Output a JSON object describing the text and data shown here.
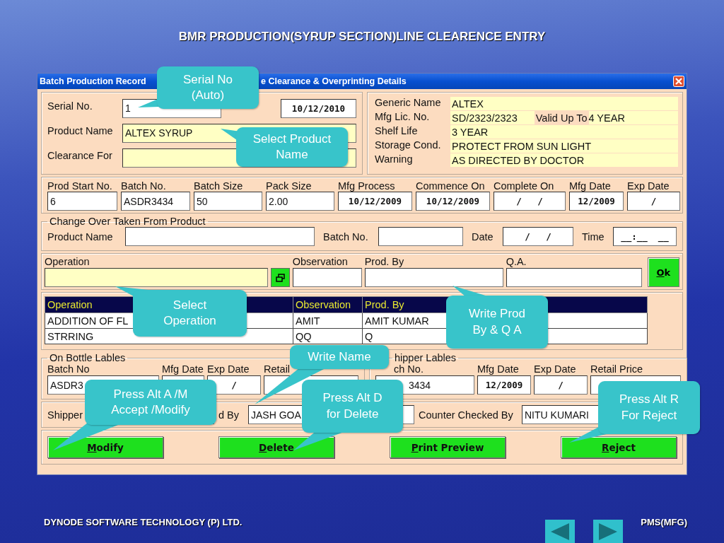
{
  "slide": {
    "title": "BMR PRODUCTION(SYRUP SECTION)LINE CLEARENCE ENTRY",
    "footer": "DYNODE SOFTWARE TECHNOLOGY (P) LTD.",
    "page_label": "PMS(MFG)"
  },
  "window": {
    "title_parts": [
      "Batch Production Record",
      "e Clearance & Overprinting Details"
    ]
  },
  "header_fields": [
    {
      "label": "Serial No.",
      "value": "1",
      "highlighted": false,
      "date": "10/12/2010"
    },
    {
      "label": "Product Name",
      "value": "ALTEX SYRUP",
      "highlighted": true
    },
    {
      "label": "Clearance For",
      "highlighted": true
    }
  ],
  "product_info": [
    {
      "label": "Generic Name",
      "value": "ALTEX"
    },
    {
      "label": "Mfg Lic. No.",
      "value": "SD/2323/2323",
      "extra_label": "Valid Up To",
      "extra_value": "4 YEAR"
    },
    {
      "label": "Shelf Life",
      "value": "3 YEAR"
    },
    {
      "label": "Storage Cond.",
      "value": "PROTECT FROM SUN LIGHT"
    },
    {
      "label": "Warning",
      "value": "AS DIRECTED BY DOCTOR"
    }
  ],
  "production": [
    {
      "label": "Prod Start No.",
      "value": "6",
      "kind": "text"
    },
    {
      "label": "Batch No.",
      "value": "ASDR3434",
      "kind": "text"
    },
    {
      "label": "Batch Size",
      "value": "50",
      "kind": "text"
    },
    {
      "label": "Pack Size",
      "value": "2.00",
      "kind": "text"
    },
    {
      "label": "Mfg Process",
      "value": "10/12/2009",
      "kind": "date"
    },
    {
      "label": "Commence On",
      "value": "10/12/2009",
      "kind": "date"
    },
    {
      "label": "Complete On",
      "value": "/   /",
      "kind": "date"
    },
    {
      "label": "Mfg Date",
      "value": "12/2009",
      "kind": "date"
    },
    {
      "label": "Exp Date",
      "value": "/",
      "kind": "date"
    }
  ],
  "change_over": {
    "legend": "Change Over Taken From Product",
    "fields": [
      {
        "label": "Product Name",
        "kind": "text"
      },
      {
        "label": "Batch No.",
        "kind": "text"
      },
      {
        "label": "Date",
        "value": "/   /",
        "kind": "date"
      },
      {
        "label": "Time",
        "value": "__:__  __",
        "kind": "date"
      }
    ]
  },
  "operation_entry": {
    "fields": [
      {
        "label": "Operation",
        "highlighted": true
      },
      {
        "label": "Observation",
        "highlighted": false
      },
      {
        "label": "Prod. By",
        "highlighted": false
      },
      {
        "label": "Q.A.",
        "highlighted": false
      }
    ],
    "ok_button": "Ok"
  },
  "operations_table": {
    "columns": [
      "Operation",
      "Observation",
      "Prod. By"
    ],
    "rows": [
      [
        "ADDITION OF FL",
        "AMIT",
        "AMIT KUMAR"
      ],
      [
        "STRRING",
        "QQ",
        "Q"
      ]
    ]
  },
  "bottle_labels": {
    "legend": "On Bottle Lables",
    "fields": [
      {
        "label": "Batch No",
        "value": "ASDR3"
      },
      {
        "label": "Mfg Date"
      },
      {
        "label": "Exp Date",
        "value": "/"
      },
      {
        "label": "Retail"
      }
    ]
  },
  "shipper_labels": {
    "legend": "hipper Lables",
    "fields": [
      {
        "label": "ch No.",
        "value": "3434"
      },
      {
        "label": "Mfg Date",
        "value": "12/2009"
      },
      {
        "label": "Exp Date",
        "value": "/"
      },
      {
        "label": "Retail Price"
      }
    ]
  },
  "checks": [
    {
      "label": "Shipper"
    },
    {
      "label": "d By",
      "value": "JASH GOA"
    },
    {
      "label": "Counter Checked By",
      "value": "NITU KUMARI"
    }
  ],
  "buttons": [
    "Modify",
    "Delete",
    "Print Preview",
    "Reject"
  ],
  "callouts": [
    {
      "text": "Serial No\n(Auto)"
    },
    {
      "text": "Select Product\nName"
    },
    {
      "text": "Select\nOperation"
    },
    {
      "text": "Write Prod\nBy & Q A"
    },
    {
      "text": "Write Name"
    },
    {
      "text": "Press Alt A /M\nAccept /Modify"
    },
    {
      "text": "Press Alt D\nfor Delete"
    },
    {
      "text": "Press Alt R\nFor Reject"
    }
  ]
}
